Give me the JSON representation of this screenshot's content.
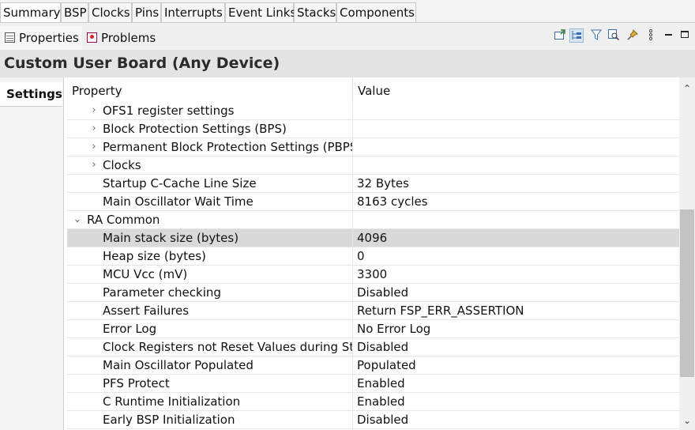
{
  "editor_tabs": [
    "Summary",
    "BSP",
    "Clocks",
    "Pins",
    "Interrupts",
    "Event Links",
    "Stacks",
    "Components"
  ],
  "view_tabs": {
    "properties": "Properties",
    "problems": "Problems"
  },
  "toolbar_icons": [
    "new-window-icon",
    "tree-view-icon",
    "filter-icon",
    "search-icon",
    "pin-icon",
    "more-vertical-icon",
    "minimize-icon",
    "maximize-icon"
  ],
  "title": "Custom User Board (Any Device)",
  "side_tab": "Settings",
  "table": {
    "headers": {
      "property": "Property",
      "value": "Value"
    },
    "rows": [
      {
        "label": "OFS1 register settings",
        "value": "",
        "expander": "›"
      },
      {
        "label": "Block Protection Settings (BPS)",
        "value": "",
        "expander": "›"
      },
      {
        "label": "Permanent Block Protection Settings (PBPS)",
        "value": "",
        "expander": "›"
      },
      {
        "label": "Clocks",
        "value": "",
        "expander": "›"
      },
      {
        "label": "Startup C-Cache Line Size",
        "value": "32 Bytes",
        "expander": ""
      },
      {
        "label": "Main Oscillator Wait Time",
        "value": "8163 cycles",
        "expander": ""
      },
      {
        "label": "RA Common",
        "value": "",
        "expander": "⌄"
      },
      {
        "label": "Main stack size (bytes)",
        "value": "4096",
        "expander": ""
      },
      {
        "label": "Heap size (bytes)",
        "value": "0",
        "expander": ""
      },
      {
        "label": "MCU Vcc (mV)",
        "value": "3300",
        "expander": ""
      },
      {
        "label": "Parameter checking",
        "value": "Disabled",
        "expander": ""
      },
      {
        "label": "Assert Failures",
        "value": "Return FSP_ERR_ASSERTION",
        "expander": ""
      },
      {
        "label": "Error Log",
        "value": "No Error Log",
        "expander": ""
      },
      {
        "label": "Clock Registers not Reset Values during Startup",
        "value": "Disabled",
        "expander": ""
      },
      {
        "label": "Main Oscillator Populated",
        "value": "Populated",
        "expander": ""
      },
      {
        "label": "PFS Protect",
        "value": "Enabled",
        "expander": ""
      },
      {
        "label": "C Runtime Initialization",
        "value": "Enabled",
        "expander": ""
      },
      {
        "label": "Early BSP Initialization",
        "value": "Disabled",
        "expander": ""
      }
    ],
    "selected_row": "Main stack size (bytes)"
  },
  "scrollbar": {
    "up": "⌃",
    "down": "⌄"
  }
}
